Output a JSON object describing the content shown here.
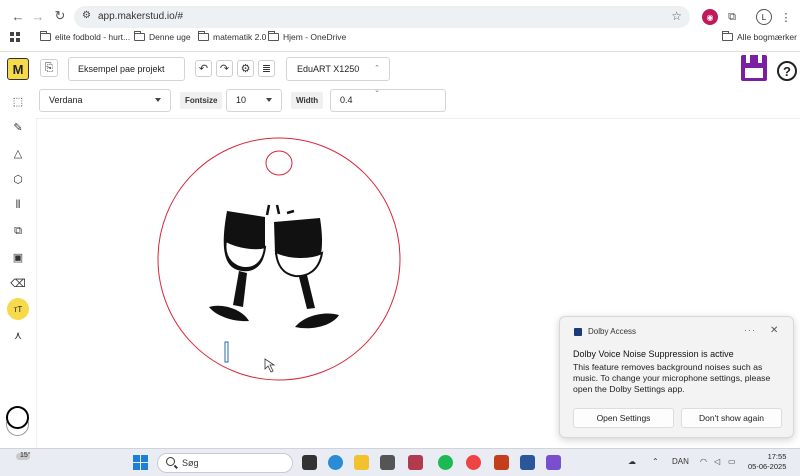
{
  "browser": {
    "url": "app.makerstud.io/#",
    "profile_initial": "L",
    "bookmarks": [
      {
        "label": "elite fodbold - hurt..."
      },
      {
        "label": "Denne uge"
      },
      {
        "label": "matematik 2.0"
      },
      {
        "label": "Hjem - OneDrive"
      }
    ],
    "all_bookmarks_label": "Alle bogmærker"
  },
  "app": {
    "logo_text": "M",
    "project_name": "Eksempel pae projekt",
    "machine_name": "EduART X1250",
    "help_label": "?"
  },
  "text_options": {
    "font": "Verdana",
    "fontsize_label": "Fontsize",
    "fontsize_value": "10",
    "width_label": "Width",
    "width_value": "0.4"
  },
  "sidebar": {
    "text_tool_label": "тT"
  },
  "notification": {
    "app_name": "Dolby Access",
    "more_label": "···",
    "close_label": "✕",
    "title": "Dolby Voice Noise Suppression is active",
    "body": "This feature removes background noises such as music. To change your microphone settings, please open the Dolby Settings app.",
    "primary_button": "Open Settings",
    "secondary_button": "Don't show again"
  },
  "taskbar": {
    "weather_temp": "15°",
    "search_placeholder": "Søg",
    "language": "DAN",
    "time": "17:55",
    "date": "05-06-2025"
  },
  "colors": {
    "accent_yellow": "#f7d94c",
    "save_purple": "#7b1fa2",
    "design_outline": "#d9263a"
  }
}
